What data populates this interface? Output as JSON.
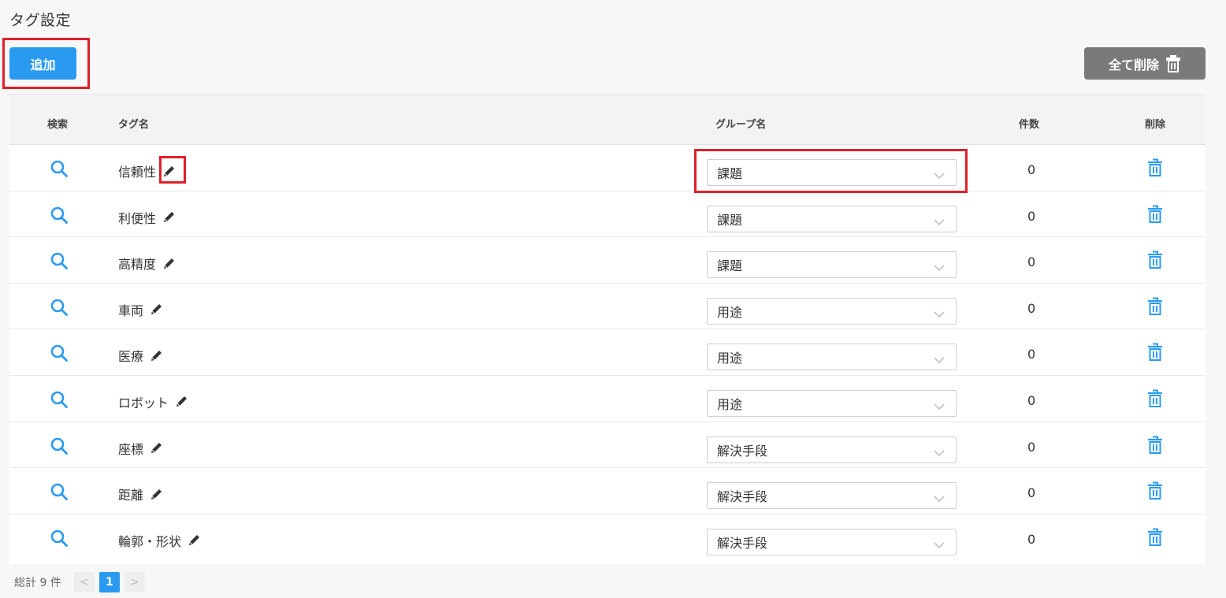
{
  "page": {
    "title": "タグ設定"
  },
  "toolbar": {
    "add_label": "追加",
    "delete_all_label": "全て削除"
  },
  "table": {
    "headers": {
      "search": "検索",
      "tag_name": "タグ名",
      "group_name": "グループ名",
      "count": "件数",
      "delete": "削除"
    },
    "rows": [
      {
        "tag": "信頼性",
        "group": "課題",
        "count": "0"
      },
      {
        "tag": "利便性",
        "group": "課題",
        "count": "0"
      },
      {
        "tag": "高精度",
        "group": "課題",
        "count": "0"
      },
      {
        "tag": "車両",
        "group": "用途",
        "count": "0"
      },
      {
        "tag": "医療",
        "group": "用途",
        "count": "0"
      },
      {
        "tag": "ロボット",
        "group": "用途",
        "count": "0"
      },
      {
        "tag": "座標",
        "group": "解決手段",
        "count": "0"
      },
      {
        "tag": "距離",
        "group": "解決手段",
        "count": "0"
      },
      {
        "tag": "輪郭・形状",
        "group": "解決手段",
        "count": "0"
      }
    ]
  },
  "footer": {
    "total_label": "総計 9 件",
    "current_page": "1",
    "prev_symbol": "<",
    "next_symbol": ">"
  },
  "colors": {
    "accent": "#2a9af0",
    "highlight": "#e0202a",
    "delete_all_bg": "#7a7a7a"
  },
  "icons": {
    "search": "search-icon",
    "edit": "pencil-icon",
    "delete": "trash-icon",
    "dropdown": "chevron-down-icon"
  }
}
